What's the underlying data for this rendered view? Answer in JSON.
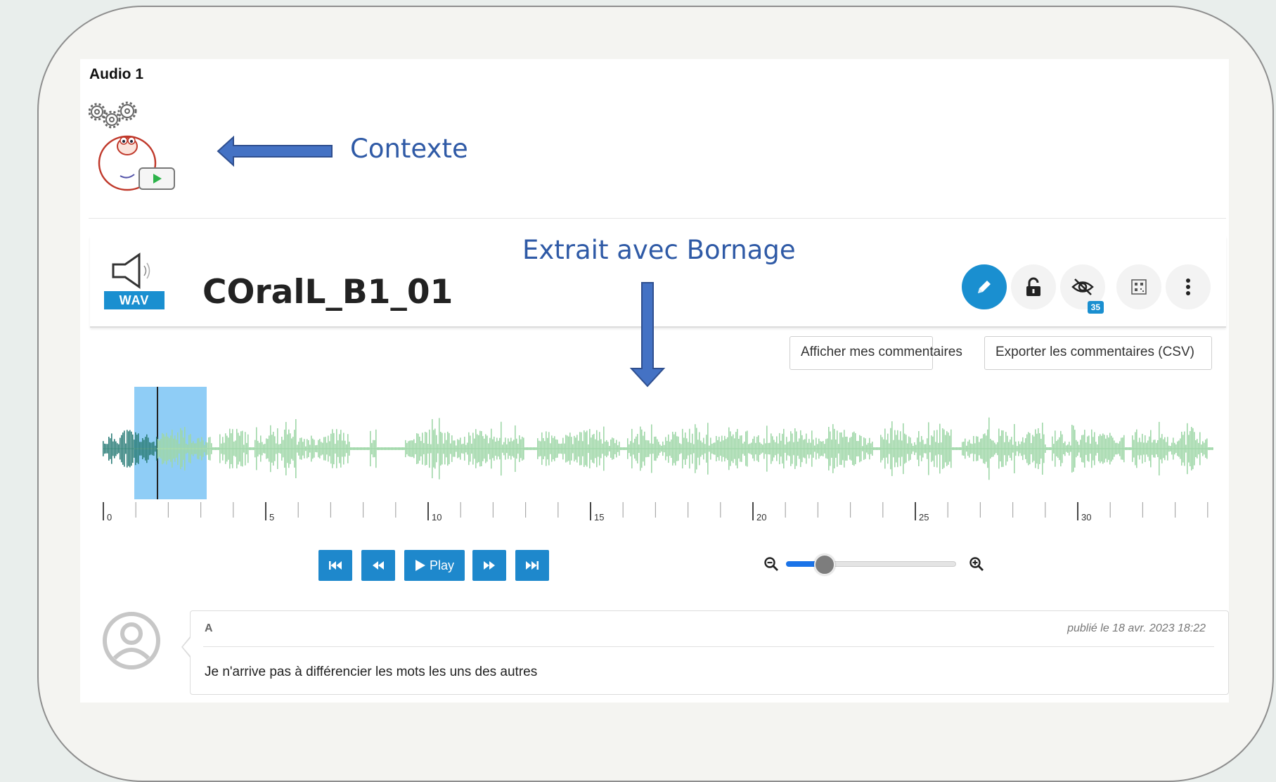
{
  "audio_section": {
    "title": "Audio 1"
  },
  "annotations": {
    "contexte": "Contexte",
    "extrait": "Extrait avec Bornage"
  },
  "document": {
    "title": "COralL_B1_01",
    "format": "WAV",
    "hidden_count": "35"
  },
  "toolbar": {
    "edit_icon": "pencil-icon",
    "lock_icon": "unlock-icon",
    "visibility_icon": "eye-off-icon",
    "qr_icon": "qr-code-icon",
    "more_icon": "more-vertical-icon"
  },
  "actions": {
    "show_comments": "Afficher mes commentaires",
    "export_comments": "Exporter les commentaires (CSV)"
  },
  "timeline": {
    "labels": [
      "0",
      "5",
      "10",
      "15",
      "20",
      "25",
      "30"
    ]
  },
  "player": {
    "play_label": "Play",
    "zoom_level": 0.22
  },
  "comment": {
    "author": "A",
    "date": "publié le 18 avr. 2023 18:22",
    "text": "Je n'arrive pas à différencier les mots les uns des autres"
  },
  "colors": {
    "accent": "#1a8fd0",
    "annotation": "#2f5aa6",
    "wave_played": "#2e7f7a",
    "wave": "#9fd7a8",
    "region": "#8fcdf6"
  }
}
